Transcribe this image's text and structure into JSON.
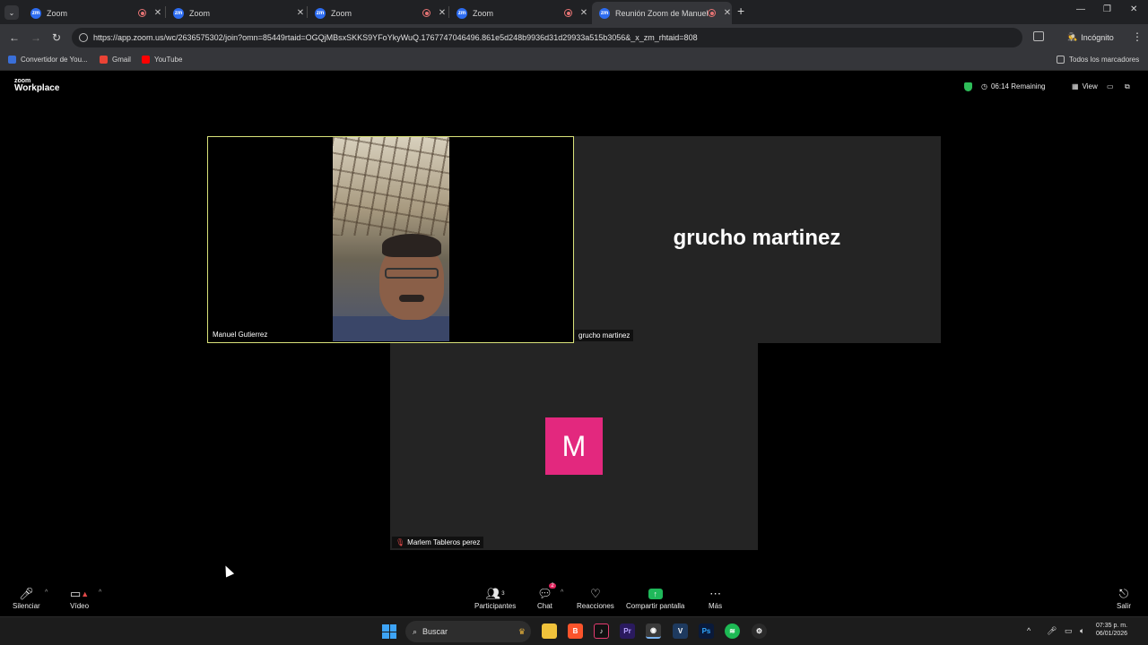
{
  "browser": {
    "tabs": [
      {
        "title": "Zoom"
      },
      {
        "title": "Zoom"
      },
      {
        "title": "Zoom"
      },
      {
        "title": "Zoom"
      },
      {
        "title": "Reunión Zoom de Manuel G"
      }
    ],
    "url": "https://app.zoom.us/wc/2636575302/join?omn=85449rtaid=OGQjMBsxSKKS9YFoYkyWuQ.1767747046496.861e5d248b9936d31d29933a515b3056&_x_zm_rhtaid=808",
    "incognito_label": "Incógnito",
    "bookmarks": [
      "Convertidor de You...",
      "Gmail",
      "YouTube"
    ],
    "all_bookmarks_label": "Todos los marcadores"
  },
  "zoom": {
    "logo_small": "zoom",
    "logo_big": "Workplace",
    "remaining": "06:14 Remaining",
    "view_label": "View",
    "participants": [
      {
        "name": "Manuel Gutierrez"
      },
      {
        "name": "grucho martinez",
        "big_name": "grucho martinez"
      },
      {
        "name": "Marlem Tableros perez",
        "avatar_letter": "M"
      }
    ],
    "toolbar": {
      "mute": "Silenciar",
      "video": "Vídeo",
      "participants": "Participantes",
      "participants_count": "3",
      "chat": "Chat",
      "chat_badge": "2",
      "reactions": "Reacciones",
      "share": "Compartir pantalla",
      "more": "Más",
      "leave": "Salir"
    }
  },
  "taskbar": {
    "search_placeholder": "Buscar",
    "time": "07:35 p. m.",
    "date": "06/01/2026"
  },
  "colors": {
    "active_speaker_border": "#d9e27a",
    "avatar_bg": "#e3287e",
    "share_green": "#1fb85a",
    "secure_green": "#2ebd59"
  }
}
